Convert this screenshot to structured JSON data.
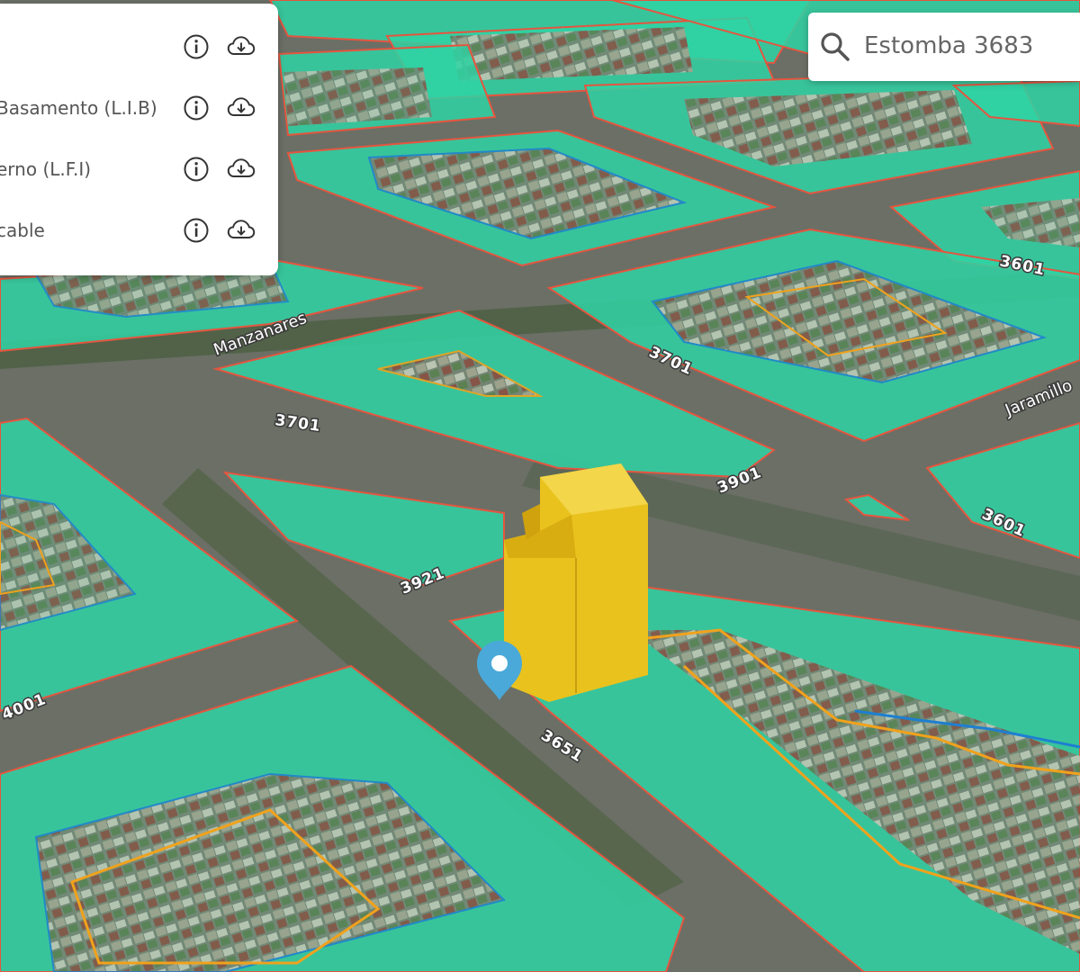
{
  "search": {
    "value": "Estomba 3683",
    "icon": "search-icon"
  },
  "layer_panel": {
    "rows": [
      {
        "label": "",
        "info_icon": "info-icon",
        "download_icon": "cloud-download-icon"
      },
      {
        "label": "Basamento (L.I.B)",
        "info_icon": "info-icon",
        "download_icon": "cloud-download-icon"
      },
      {
        "label": "erno (L.F.I)",
        "info_icon": "info-icon",
        "download_icon": "cloud-download-icon"
      },
      {
        "label": "cable",
        "info_icon": "info-icon",
        "download_icon": "cloud-download-icon"
      }
    ]
  },
  "map": {
    "street_numbers": [
      "3651",
      "3921",
      "3701",
      "3901",
      "3601",
      "4001",
      "3601",
      "3701"
    ],
    "street_names": [
      "Manzanares",
      "Jaramillo"
    ],
    "colors": {
      "block_fill": "#2fd3a4",
      "block_border": "#e5553f",
      "building": "#e9c21e",
      "lib_line": "#f0a21c",
      "lfi_line": "#1e7fd0",
      "pin": "#4aa9d8"
    },
    "pin_icon": "location-pin-icon"
  }
}
